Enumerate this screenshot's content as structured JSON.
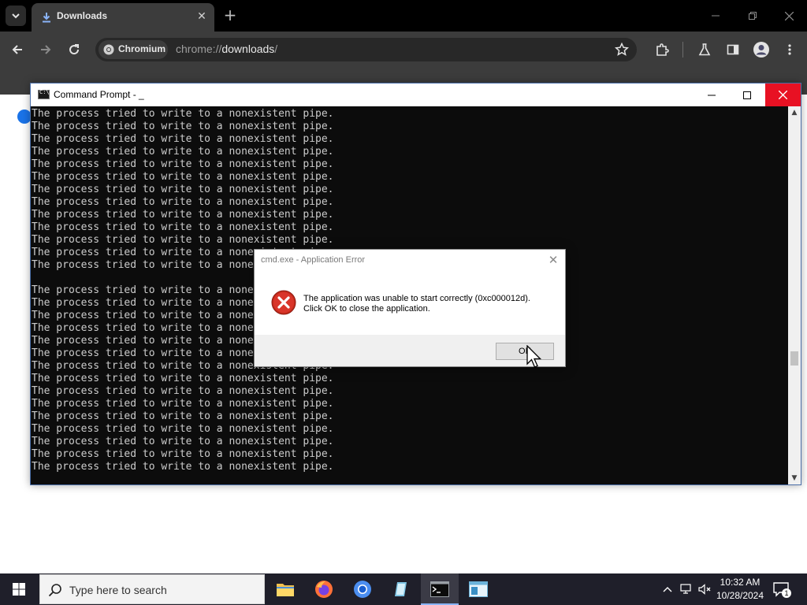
{
  "browser": {
    "tab_title": "Downloads",
    "site_chip": "Chromium",
    "url_prefix": "chrome://",
    "url_path": "downloads",
    "url_suffix": "/"
  },
  "cmd": {
    "title": "Command Prompt - _",
    "lines": [
      "The process tried to write to a nonexistent pipe.",
      "The process tried to write to a nonexistent pipe.",
      "The process tried to write to a nonexistent pipe.",
      "The process tried to write to a nonexistent pipe.",
      "The process tried to write to a nonexistent pipe.",
      "The process tried to write to a nonexistent pipe.",
      "The process tried to write to a nonexistent pipe.",
      "The process tried to write to a nonexistent pipe.",
      "The process tried to write to a nonexistent pipe.",
      "The process tried to write to a nonexistent pipe.",
      "The process tried to write to a nonexistent pipe.",
      "The process tried to write to a nonexistent pipe.",
      "The process tried to write to a nonexistent pipe.",
      "",
      "The process tried to write to a nonexistent pipe.",
      "The process tried to write to a nonexistent pipe.",
      "The process tried to write to a nonexistent pipe.",
      "The process tried to write to a nonexistent pipe.",
      "The process tried to write to a nonexistent pipe.",
      "The process tried to write to a nonexistent pipe.",
      "The process tried to write to a nonexistent pipe.",
      "The process tried to write to a nonexistent pipe.",
      "The process tried to write to a nonexistent pipe.",
      "The process tried to write to a nonexistent pipe.",
      "The process tried to write to a nonexistent pipe.",
      "The process tried to write to a nonexistent pipe.",
      "The process tried to write to a nonexistent pipe.",
      "The process tried to write to a nonexistent pipe.",
      "The process tried to write to a nonexistent pipe."
    ]
  },
  "dialog": {
    "title": "cmd.exe - Application Error",
    "message_line1": "The application was unable to start correctly (0xc000012d).",
    "message_line2": "Click OK to close the application.",
    "ok_label": "OK"
  },
  "taskbar": {
    "search_placeholder": "Type here to search",
    "time": "10:32 AM",
    "date": "10/28/2024",
    "notification_count": "1",
    "apps": [
      "file-explorer",
      "firefox",
      "chromium",
      "notepad",
      "command-prompt",
      "terminal"
    ]
  },
  "colors": {
    "console_bg": "#0c0c0c",
    "console_text": "#cccccc",
    "close_red": "#e81123",
    "browser_toolbar": "#3c3c3c",
    "taskbar_bg": "#1f1f2a",
    "accent_blue": "#1a73e8"
  }
}
